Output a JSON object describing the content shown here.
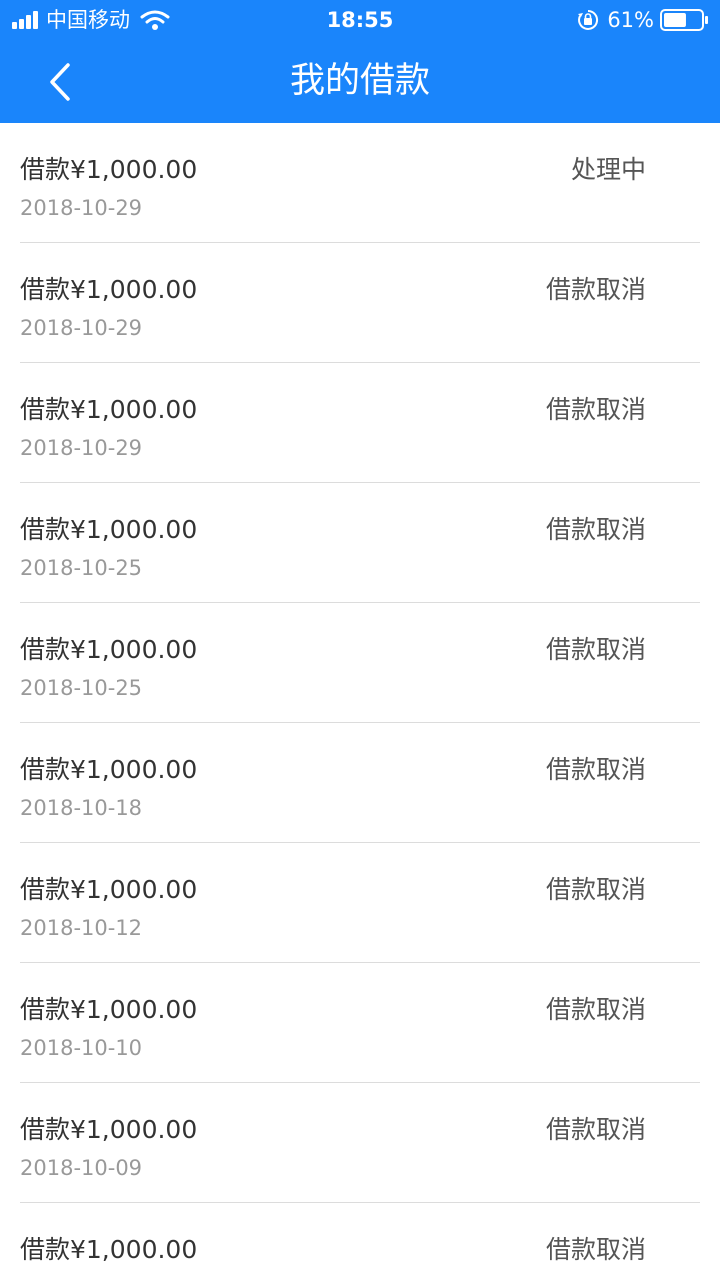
{
  "status_bar": {
    "carrier": "中国移动",
    "time": "18:55",
    "battery": "61%",
    "battery_level": 0.61
  },
  "nav": {
    "title": "我的借款"
  },
  "colors": {
    "header": "#1a85fb",
    "amount_text": "#333333",
    "date_text": "#999999",
    "status_text": "#555555",
    "divider": "#dcdcdc"
  },
  "icons": {
    "back": "chevron-left-icon",
    "wifi": "wifi-icon",
    "orientation_lock": "lock-rotation-icon",
    "battery": "battery-icon",
    "signal": "signal-icon"
  },
  "loans": [
    {
      "amount": "借款¥1,000.00",
      "date": "2018-10-29",
      "status": "处理中"
    },
    {
      "amount": "借款¥1,000.00",
      "date": "2018-10-29",
      "status": "借款取消"
    },
    {
      "amount": "借款¥1,000.00",
      "date": "2018-10-29",
      "status": "借款取消"
    },
    {
      "amount": "借款¥1,000.00",
      "date": "2018-10-25",
      "status": "借款取消"
    },
    {
      "amount": "借款¥1,000.00",
      "date": "2018-10-25",
      "status": "借款取消"
    },
    {
      "amount": "借款¥1,000.00",
      "date": "2018-10-18",
      "status": "借款取消"
    },
    {
      "amount": "借款¥1,000.00",
      "date": "2018-10-12",
      "status": "借款取消"
    },
    {
      "amount": "借款¥1,000.00",
      "date": "2018-10-10",
      "status": "借款取消"
    },
    {
      "amount": "借款¥1,000.00",
      "date": "2018-10-09",
      "status": "借款取消"
    },
    {
      "amount": "借款¥1,000.00",
      "date": "",
      "status": "借款取消"
    }
  ]
}
